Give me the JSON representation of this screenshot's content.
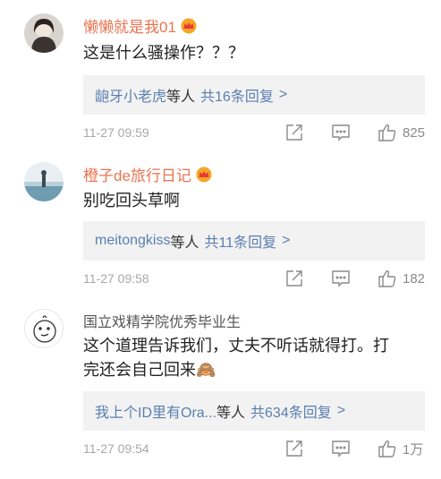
{
  "comments": [
    {
      "username": "懒懒就是我01",
      "text": "这是什么骚操作？？？",
      "reply_names": "龅牙小老虎",
      "reply_suffix": "等人",
      "reply_count": "共16条回复",
      "reply_more": ">",
      "time": "11-27 09:59",
      "likes": "825"
    },
    {
      "username": "橙子de旅行日记",
      "text": "别吃回头草啊",
      "reply_names": "meitongkiss",
      "reply_suffix": "等人",
      "reply_count": "共11条回复",
      "reply_more": ">",
      "time": "11-27 09:58",
      "likes": "182"
    },
    {
      "username": "国立戏精学院优秀毕业生",
      "text_line1": "这个道理告诉我们，丈夫不听话就得打。打",
      "text_line2": "完还会自己回来",
      "emoji": "🙈",
      "reply_names": "我上个ID里有Ora...",
      "reply_suffix": "等人",
      "reply_count": "共634条回复",
      "reply_more": ">",
      "time": "11-27 09:54",
      "likes": "1万"
    }
  ],
  "colors": {
    "username_vip": "#eb7350",
    "link": "#5b7fb0",
    "meta": "#a8a8a8",
    "reply_bg": "#f2f2f2"
  },
  "icons": {
    "share": "share-icon",
    "comment": "comment-icon",
    "like": "like-icon",
    "crown": "crown-badge-icon"
  }
}
